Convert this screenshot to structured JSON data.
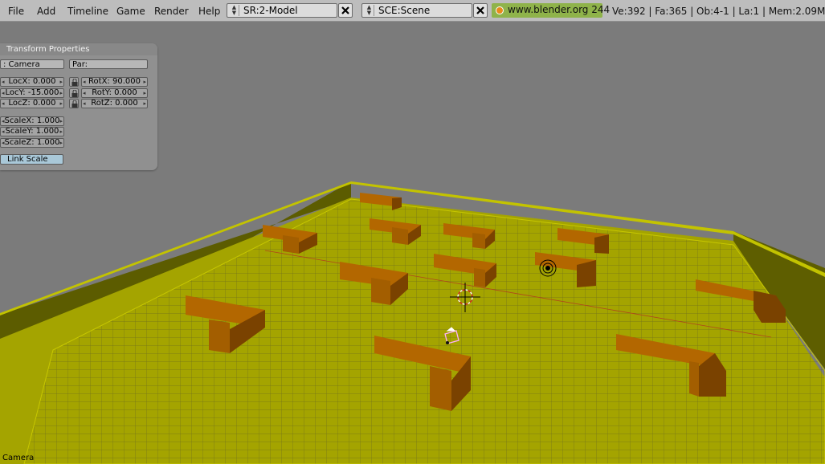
{
  "menu": {
    "file": "File",
    "add": "Add",
    "timeline": "Timeline",
    "game": "Game",
    "render": "Render",
    "help": "Help"
  },
  "screen_selector": {
    "value": "SR:2-Model"
  },
  "scene_selector": {
    "value": "SCE:Scene"
  },
  "website": {
    "label": "www.blender.org 244"
  },
  "stats": {
    "text": "Ve:392 | Fa:365 | Ob:4-1 | La:1  | Mem:2.09M"
  },
  "transform_panel": {
    "title": "Transform Properties",
    "object_name": ": Camera",
    "parent": "Par:",
    "loc": [
      "LocX: 0.000",
      "LocY: -15.000",
      "LocZ: 0.000"
    ],
    "rot": [
      "RotX: 90.000",
      "RotY: 0.000",
      "RotZ: 0.000"
    ],
    "scale": [
      "ScaleX: 1.000",
      "ScaleY: 1.000",
      "ScaleZ: 1.000"
    ],
    "link_scale": "Link Scale"
  },
  "viewport": {
    "object_label": "Camera"
  },
  "colors": {
    "ground": "#a4a400",
    "walls": "#b5b500",
    "blocks": "#a25a00",
    "background": "#7b7b7b"
  },
  "icons": [
    "arrows-updown-icon",
    "close-x-icon",
    "blender-logo-icon",
    "lock-icon",
    "arrow-left-icon",
    "arrow-right-icon",
    "3d-cursor-icon",
    "lamp-icon",
    "camera-icon"
  ]
}
